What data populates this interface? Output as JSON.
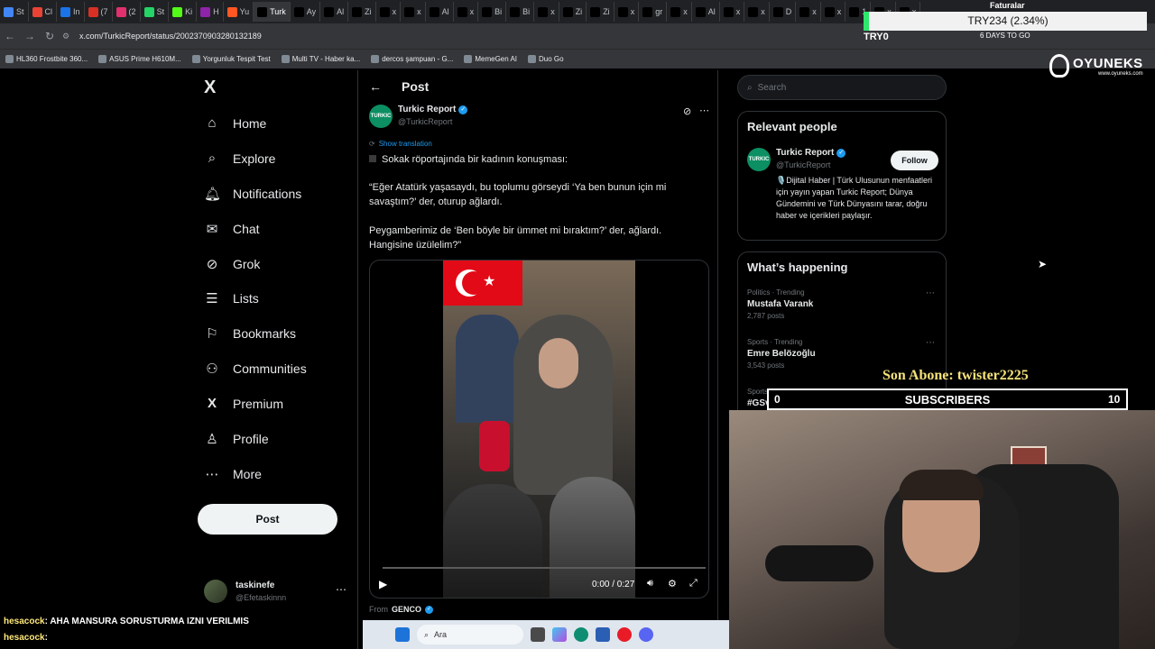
{
  "browser": {
    "tabs": [
      {
        "label": "St",
        "color": "#4285f4"
      },
      {
        "label": "Cl",
        "color": "#ea4335"
      },
      {
        "label": "In",
        "color": "#1a73e8"
      },
      {
        "label": "(7",
        "color": "#d93025"
      },
      {
        "label": "(2",
        "color": "#e1306c"
      },
      {
        "label": "St",
        "color": "#25d366"
      },
      {
        "label": "Ki",
        "color": "#53fc18"
      },
      {
        "label": "H",
        "color": "#8e24aa"
      },
      {
        "label": "Yu",
        "color": "#ff5722"
      },
      {
        "label": "Turk",
        "color": "#000000"
      },
      {
        "label": "Ay",
        "color": "#000000"
      },
      {
        "label": "Al",
        "color": "#000000"
      },
      {
        "label": "Zi",
        "color": "#000000"
      },
      {
        "label": "x",
        "color": "#000000"
      },
      {
        "label": "x",
        "color": "#000000"
      },
      {
        "label": "Al",
        "color": "#000000"
      },
      {
        "label": "x",
        "color": "#000000"
      },
      {
        "label": "Bi",
        "color": "#000000"
      },
      {
        "label": "Bi",
        "color": "#000000"
      },
      {
        "label": "x",
        "color": "#000000"
      },
      {
        "label": "Zi",
        "color": "#000000"
      },
      {
        "label": "Zi",
        "color": "#000000"
      },
      {
        "label": "x",
        "color": "#000000"
      },
      {
        "label": "gr",
        "color": "#000000"
      },
      {
        "label": "x",
        "color": "#000000"
      },
      {
        "label": "Al",
        "color": "#000000"
      },
      {
        "label": "x",
        "color": "#000000"
      },
      {
        "label": "x",
        "color": "#000000"
      },
      {
        "label": "D",
        "color": "#000000"
      },
      {
        "label": "x",
        "color": "#000000"
      },
      {
        "label": "x",
        "color": "#000000"
      },
      {
        "label": "1",
        "color": "#000000"
      },
      {
        "label": "x",
        "color": "#000000"
      },
      {
        "label": "x",
        "color": "#000000"
      }
    ],
    "url": "x.com/TurkicReport/status/2002370903280132189",
    "bookmarks": [
      "HL360 Frostbite 360...",
      "ASUS Prime H610M...",
      "Yorgunluk Tespit Test",
      "Multi TV - Haber ka...",
      "dercos şampuan - G...",
      "MemeGen AI",
      "Duo Go"
    ]
  },
  "stream_overlay": {
    "ticker_label": "TRY234 (2.34%)",
    "ticker_left": "TRY0",
    "days_to_go": "6 DAYS TO GO",
    "faturalar": "Faturalar",
    "oyuneks": "OYUNEKS",
    "oyuneks_url": "www.oyuneks.com",
    "last_sub_label": "Son Abone: twister2225",
    "sub_bar_left": "0",
    "sub_bar_title": "SUBSCRIBERS",
    "sub_bar_right": "10",
    "sub_progress": 0.0,
    "chat": [
      {
        "user": "hesacock",
        "text": ": AHA MANSURA SORUSTURMA IZNI VERILMIS"
      },
      {
        "user": "hesacock",
        "text": ":"
      }
    ],
    "taskbar_search": "Ara"
  },
  "nav": {
    "logo": "X",
    "items": [
      {
        "label": "Home",
        "icon": "⌂",
        "icon_name": "home-icon"
      },
      {
        "label": "Explore",
        "icon": "⌕",
        "icon_name": "search-icon"
      },
      {
        "label": "Notifications",
        "icon": "🔔︎",
        "icon_name": "bell-icon"
      },
      {
        "label": "Chat",
        "icon": "✉",
        "icon_name": "mail-icon"
      },
      {
        "label": "Grok",
        "icon": "⊘",
        "icon_name": "grok-icon"
      },
      {
        "label": "Lists",
        "icon": "☰",
        "icon_name": "list-icon"
      },
      {
        "label": "Bookmarks",
        "icon": "⚐",
        "icon_name": "bookmark-icon"
      },
      {
        "label": "Communities",
        "icon": "⚇",
        "icon_name": "communities-icon"
      },
      {
        "label": "Premium",
        "icon": "X",
        "icon_name": "premium-icon"
      },
      {
        "label": "Profile",
        "icon": "♙",
        "icon_name": "profile-icon"
      },
      {
        "label": "More",
        "icon": "⋯",
        "icon_name": "more-icon"
      }
    ],
    "post_button": "Post",
    "account_name": "taskinefe",
    "account_handle": "@Efetaskinnn"
  },
  "post": {
    "header_title": "Post",
    "author_name": "Turkic Report",
    "author_handle": "@TurkicReport",
    "show_translation": "Show translation",
    "line1": "Sokak röportajında bir kadının konuşması:",
    "quote1": "“Eğer Atatürk yaşasaydı, bu toplumu görseydi ‘Ya ben bunun için mi savaştım?’ der, oturup ağlardı.",
    "quote2": "Peygamberimiz de ‘Ben böyle bir ümmet mi bıraktım?’ der, ağlardı. Hangisine üzülelim?”",
    "video_time": "0:00 / 0:27",
    "from_label": "From",
    "from_name": "GENCO"
  },
  "sidebar": {
    "search_placeholder": "Search",
    "relevant_title": "Relevant people",
    "person_name": "Turkic Report",
    "person_handle": "@TurkicReport",
    "follow_label": "Follow",
    "person_bio": "🎙️Dijital Haber | Türk Ulusunun menfaatleri için yayın yapan Turkic Report; Dünya Gündemini ve Türk Dünyasını tarar, doğru haber ve içerikleri paylaşır.",
    "happening_title": "What’s happening",
    "trends": [
      {
        "meta": "Politics · Trending",
        "name": "Mustafa Varank",
        "count": "2,787 posts"
      },
      {
        "meta": "Sports · Trending",
        "name": "Emre Belözoğlu",
        "count": "3,543 posts"
      },
      {
        "meta": "Sports · Trending",
        "name": "#GSvRSP",
        "count": ""
      }
    ]
  }
}
